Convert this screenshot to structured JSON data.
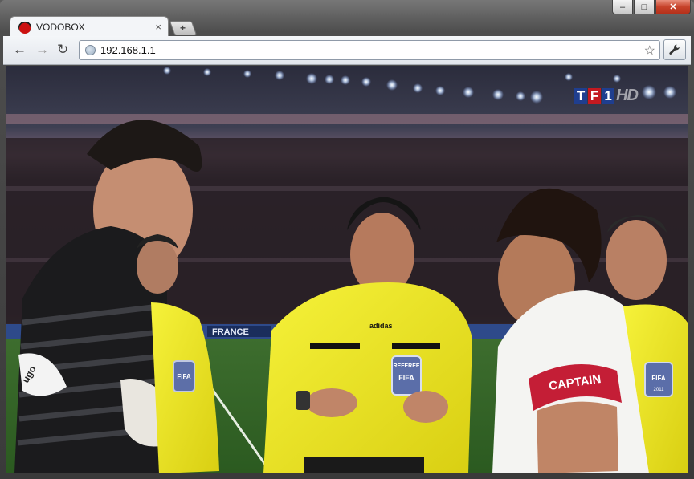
{
  "window": {
    "controls": {
      "minimize": "–",
      "maximize": "□",
      "close": "✕"
    }
  },
  "tab": {
    "title": "VODOBOX",
    "favicon": "tf1-favicon-icon",
    "close_label": "×"
  },
  "new_tab_label": "+",
  "toolbar": {
    "back": "←",
    "forward": "→",
    "reload": "↻",
    "url": "192.168.1.1",
    "star": "☆"
  },
  "overlay": {
    "channel_logo_letters": [
      "T",
      "F",
      "1"
    ],
    "hd_label": "HD",
    "colors": {
      "t": "#1f3e8f",
      "f": "#c41920",
      "one": "#1f3e8f"
    }
  },
  "video_scene": {
    "banner_text": "FRANCE",
    "armband_text": "CAPTAIN",
    "badge_text": "FIFA",
    "referee_badge_top": "REFEREE",
    "referee_badge_bottom": "FIFA",
    "right_badge_year": "2011",
    "glove_text": "ugo",
    "shirt_brand": "adidas"
  }
}
